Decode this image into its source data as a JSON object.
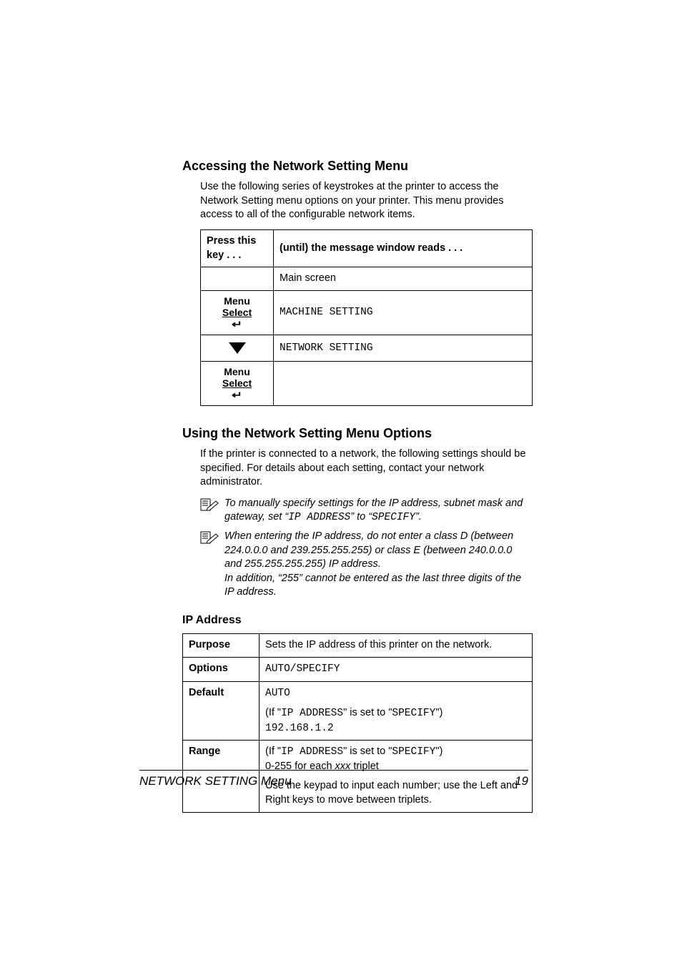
{
  "sec1": {
    "title": "Accessing the Network Setting Menu",
    "intro": "Use the following series of keystrokes at the printer to access the Network Setting menu options on your printer. This menu provides access to all of the configurable network items.",
    "table": {
      "h1": "Press this key . . .",
      "h2": "(until) the message window reads . . .",
      "r1c2": "Main screen",
      "menu_label_l1": "Menu",
      "menu_label_l2": "Select",
      "r2c2": "MACHINE SETTING",
      "r3c2": "NETWORK SETTING"
    }
  },
  "sec2": {
    "title": "Using the Network Setting Menu Options",
    "intro": "If the printer is connected to a network, the following settings should be specified. For details about each setting, contact your network administrator.",
    "note1_a": "To manually specify settings for the IP address, subnet mask and gateway, set “",
    "note1_b": "IP ADDRESS",
    "note1_c": "” to “",
    "note1_d": "SPECIFY",
    "note1_e": "”.",
    "note2_a": "When entering the IP address, do not enter a class D (between 224.0.0.0 and 239.255.255.255) or class E (between 240.0.0.0 and 255.255.255.255) IP address.",
    "note2_b": "In addition, “255” cannot be entered as the last three digits of the IP address."
  },
  "ip": {
    "title": "IP Address",
    "purpose_l": "Purpose",
    "purpose_v": "Sets the IP address of this printer on the network.",
    "options_l": "Options",
    "options_v": "AUTO/SPECIFY",
    "default_l": "Default",
    "default_v1": "AUTO",
    "default_v2a": "(If \"",
    "default_v2b": "IP ADDRESS",
    "default_v2c": "\" is set to \"",
    "default_v2d": "SPECIFY",
    "default_v2e": "\")",
    "default_v3": "192.168.1.2",
    "range_l": "Range",
    "range_v1a": "(If \"",
    "range_v1b": "IP ADDRESS",
    "range_v1c": "\" is set to \"",
    "range_v1d": "SPECIFY",
    "range_v1e": "\")",
    "range_v2a": "0-255 for each ",
    "range_v2b": "xxx",
    "range_v2c": " triplet",
    "range_v3": "Use the keypad to input each number; use the Left and Right keys to move between triplets."
  },
  "footer": {
    "title": "NETWORK SETTING Menu",
    "page": "19"
  }
}
